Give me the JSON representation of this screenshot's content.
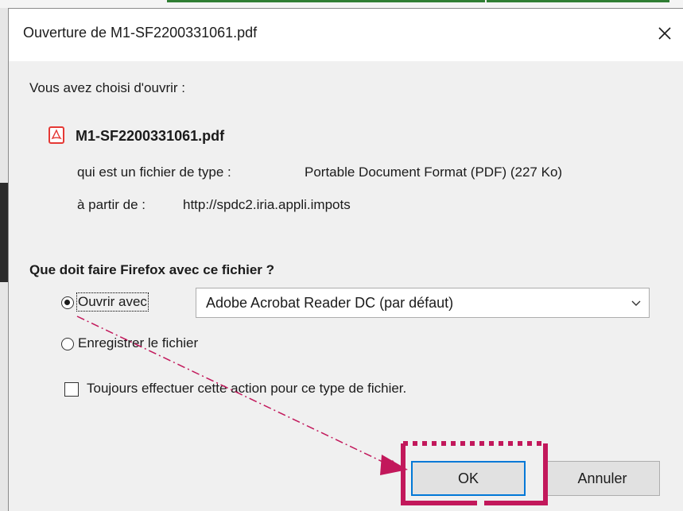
{
  "dialog": {
    "title": "Ouverture de M1-SF2200331061.pdf",
    "intro": "Vous avez choisi d'ouvrir :",
    "file_name": "M1-SF2200331061.pdf",
    "type_label": "qui est un fichier de type :",
    "type_value": "Portable Document Format (PDF) (227 Ko)",
    "from_label": "à partir de :",
    "from_value": "http://spdc2.iria.appli.impots",
    "question": "Que doit faire Firefox avec ce fichier ?",
    "open_with_label": "Ouvrir avec",
    "open_with_app": "Adobe Acrobat Reader DC (par défaut)",
    "save_label": "Enregistrer le fichier",
    "always_label": "Toujours effectuer cette action pour ce type de fichier.",
    "ok_label": "OK",
    "cancel_label": "Annuler"
  },
  "state": {
    "open_with_selected": true,
    "save_selected": false,
    "always_checked": false
  },
  "colors": {
    "highlight": "#c2185b",
    "focus_blue": "#0078d7",
    "pdf_red": "#e53935"
  }
}
